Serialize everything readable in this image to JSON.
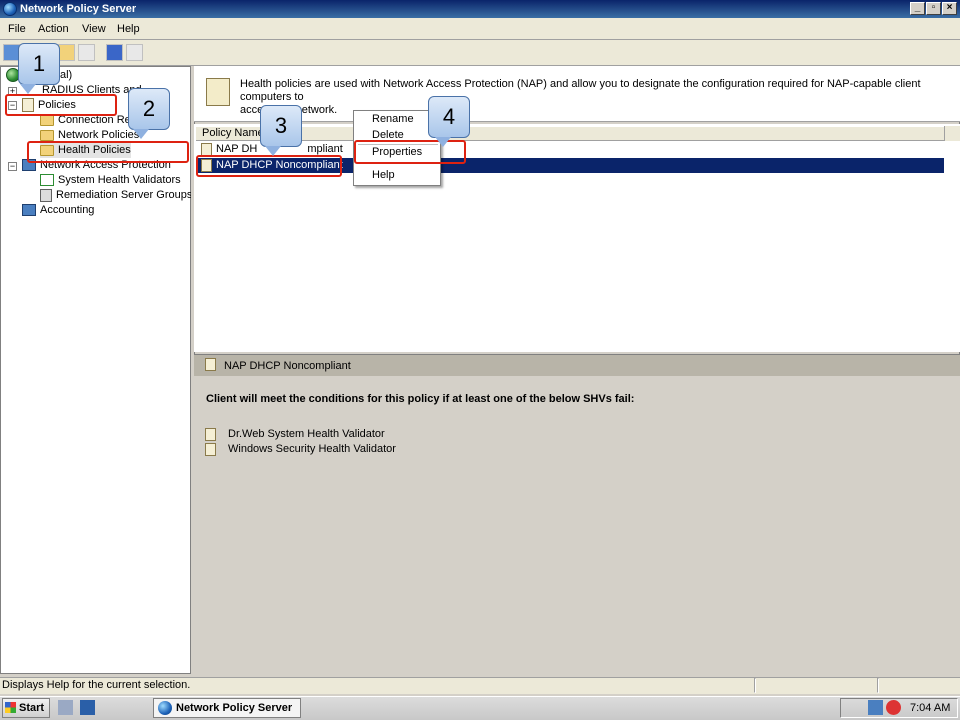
{
  "window": {
    "title": "Network Policy Server"
  },
  "menu": {
    "items": [
      "File",
      "Action",
      "View",
      "Help"
    ]
  },
  "tree": {
    "items": [
      {
        "label": "al)"
      },
      {
        "label": "RADIUS Clients and"
      },
      {
        "label": "Policies"
      },
      {
        "label": "Connection Re"
      },
      {
        "label": "es"
      },
      {
        "label": "Network Policies"
      },
      {
        "label": "Health Policies"
      },
      {
        "label": "Network Access Protection"
      },
      {
        "label": "System Health Validators"
      },
      {
        "label": "Remediation Server Groups"
      },
      {
        "label": "Accounting"
      }
    ]
  },
  "info": {
    "line1": "Health policies are used with Network Access Protection (NAP) and allow you to designate the configuration required for NAP-capable client computers to",
    "line2": "access the network."
  },
  "list": {
    "column_header": "Policy Name",
    "rows": [
      {
        "name": "NAP DH"
      },
      {
        "name": "mpliant"
      },
      {
        "name": "NAP DHCP Noncompliant"
      }
    ]
  },
  "context_menu": {
    "items": [
      "Rename",
      "Delete",
      "Properties",
      "Help"
    ]
  },
  "detail": {
    "title": "NAP DHCP Noncompliant",
    "condition": "Client will meet the conditions for this policy if at least one of the below SHVs fail:",
    "shvs": [
      "Dr.Web System Health Validator",
      "Windows Security Health Validator"
    ]
  },
  "status": {
    "text": "Displays Help for the current selection."
  },
  "taskbar": {
    "start": "Start",
    "app": "Network Policy Server",
    "clock": "7:04 AM"
  },
  "callouts": [
    "1",
    "2",
    "3",
    "4"
  ],
  "colors": {
    "title_bar": "#0a246a",
    "selection": "#0a246a",
    "highlight": "#dd2211",
    "callout": "#a9c6ea"
  }
}
